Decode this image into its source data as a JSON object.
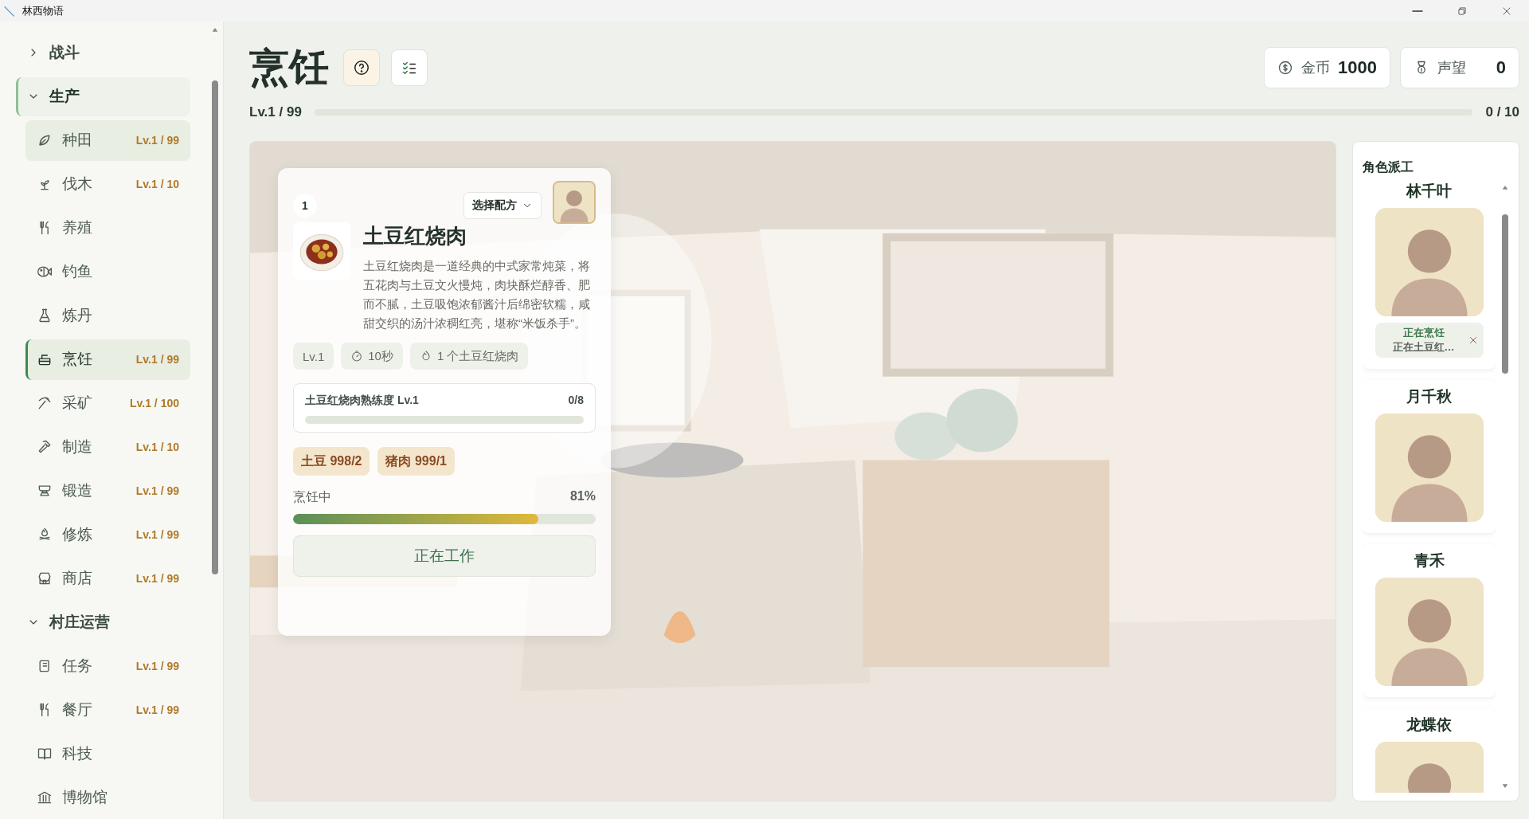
{
  "window": {
    "title": "林西物语"
  },
  "sidebar": {
    "sections": [
      {
        "label": "战斗",
        "expanded": false,
        "active": false
      },
      {
        "label": "生产",
        "expanded": true,
        "active": true,
        "items": [
          {
            "label": "种田",
            "level": "Lv.1 / 99",
            "selected": false,
            "hovered": true
          },
          {
            "label": "伐木",
            "level": "Lv.1 / 10",
            "selected": false,
            "hovered": false
          },
          {
            "label": "养殖",
            "selected": false,
            "hovered": false
          },
          {
            "label": "钓鱼",
            "selected": false,
            "hovered": false
          },
          {
            "label": "炼丹",
            "selected": false,
            "hovered": false
          },
          {
            "label": "烹饪",
            "level": "Lv.1 / 99",
            "selected": true,
            "hovered": false
          },
          {
            "label": "采矿",
            "level": "Lv.1 / 100",
            "selected": false,
            "hovered": false
          },
          {
            "label": "制造",
            "level": "Lv.1 / 10",
            "selected": false,
            "hovered": false
          },
          {
            "label": "锻造",
            "level": "Lv.1 / 99",
            "selected": false,
            "hovered": false
          },
          {
            "label": "修炼",
            "level": "Lv.1 / 99",
            "selected": false,
            "hovered": false
          },
          {
            "label": "商店",
            "level": "Lv.1 / 99",
            "selected": false,
            "hovered": false
          }
        ]
      },
      {
        "label": "村庄运营",
        "expanded": true,
        "active": false,
        "items": [
          {
            "label": "任务",
            "level": "Lv.1 / 99",
            "selected": false,
            "hovered": false
          },
          {
            "label": "餐厅",
            "level": "Lv.1 / 99",
            "selected": false,
            "hovered": false
          },
          {
            "label": "科技",
            "selected": false,
            "hovered": false
          },
          {
            "label": "博物馆",
            "selected": false,
            "hovered": false
          }
        ]
      }
    ]
  },
  "header": {
    "title": "烹饪",
    "currencies": [
      {
        "label": "金币",
        "value": "1000"
      },
      {
        "label": "声望",
        "value": "0"
      }
    ],
    "skill": {
      "text": "Lv.1 / 99",
      "level": 0,
      "reading": "0 / 10"
    }
  },
  "recipe_card": {
    "slot": "1",
    "recipe_select": "选择配方",
    "name": "土豆红烧肉",
    "description": "土豆红烧肉是一道经典的中式家常炖菜，将五花肉与土豆文火慢炖，肉块酥烂醇香、肥而不腻，土豆吸饱浓郁酱汁后绵密软糯，咸甜交织的汤汁浓稠红亮，堪称“米饭杀手”。",
    "chips": [
      {
        "kind": "level",
        "text": "Lv.1"
      },
      {
        "kind": "time",
        "text": "10秒"
      },
      {
        "kind": "output",
        "text": "1 个土豆红烧肉"
      }
    ],
    "mastery": {
      "label": "土豆红烧肉熟练度 Lv.1",
      "reading": "0/8",
      "level": 0
    },
    "ingredients": [
      "土豆 998/2",
      "猪肉 999/1"
    ],
    "progress": {
      "label": "烹饪中",
      "reading": "81%",
      "level": 0.81
    },
    "action": "正在工作"
  },
  "workers": {
    "title": "角色派工",
    "items": [
      {
        "name": "林千叶",
        "busy": true,
        "status": "正在烹饪",
        "task": "正在土豆红…"
      },
      {
        "name": "月千秋",
        "busy": false
      },
      {
        "name": "青禾",
        "busy": false
      },
      {
        "name": "龙蝶依",
        "busy": false
      }
    ]
  }
}
